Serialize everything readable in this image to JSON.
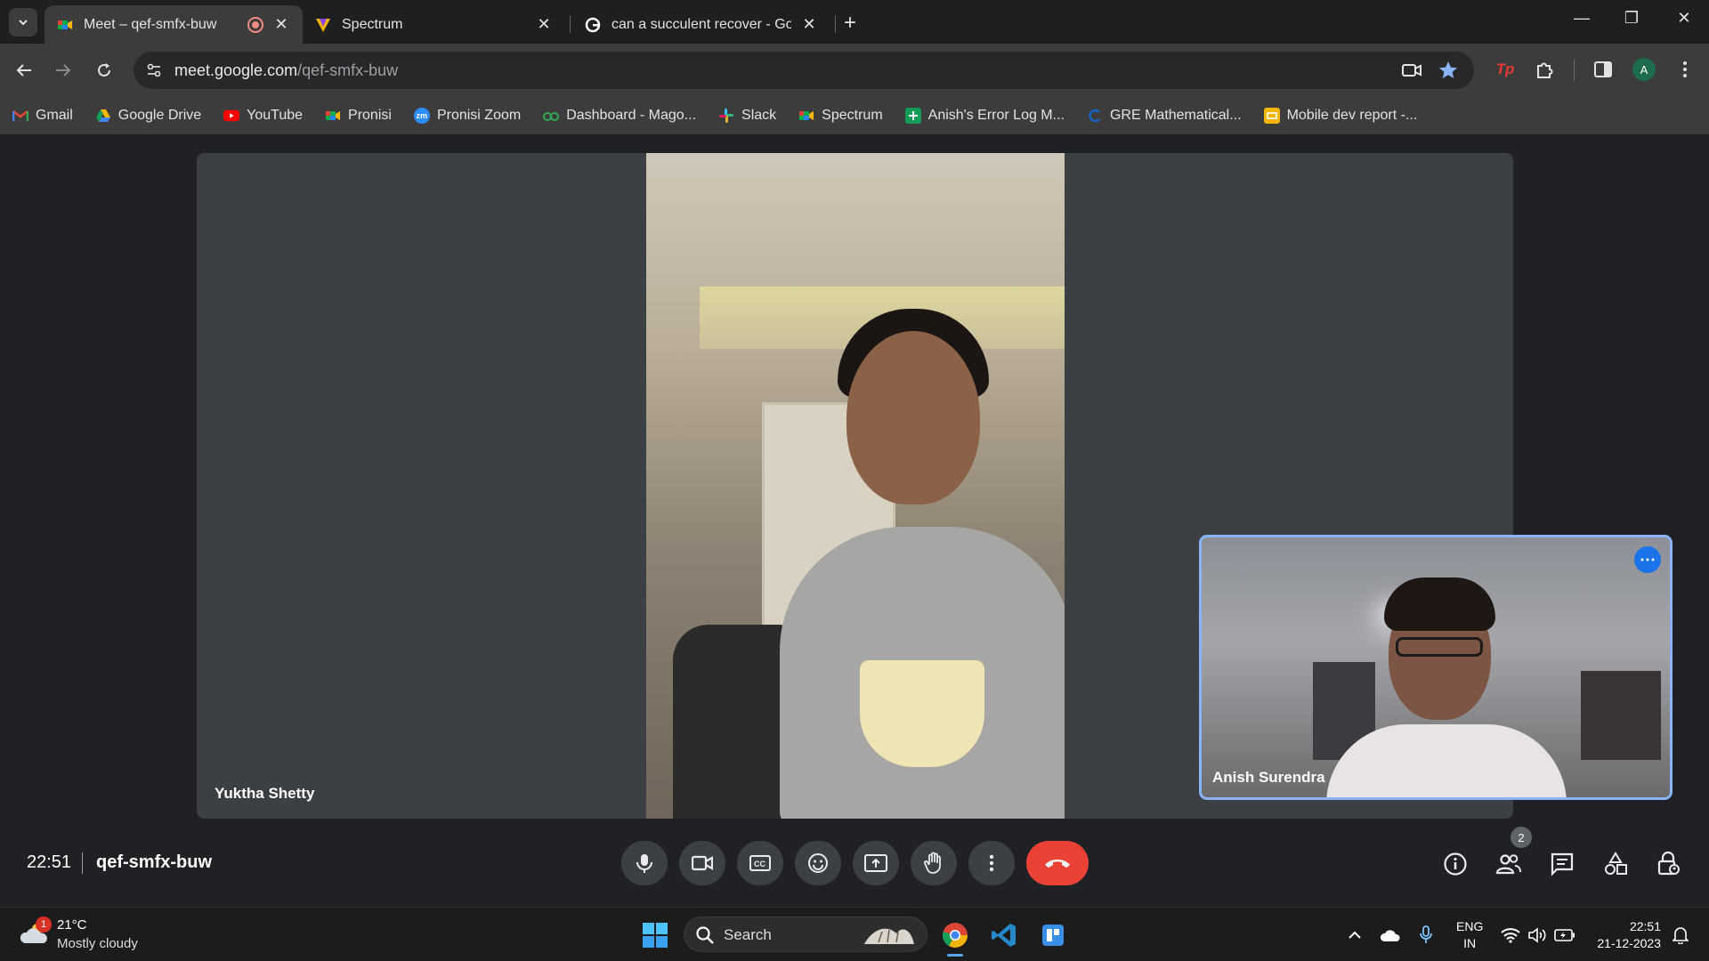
{
  "browser": {
    "tabs": [
      {
        "title": "Meet – qef-smfx-buw",
        "active": true,
        "recording": true
      },
      {
        "title": "Spectrum",
        "active": false
      },
      {
        "title": "can a succulent recover - Google",
        "active": false
      }
    ],
    "url_host": "meet.google.com",
    "url_path": "/qef-smfx-buw",
    "profile_initial": "A",
    "bookmarks": [
      {
        "label": "Gmail",
        "icon": "gmail-icon"
      },
      {
        "label": "Google Drive",
        "icon": "google-drive-icon"
      },
      {
        "label": "YouTube",
        "icon": "youtube-icon"
      },
      {
        "label": "Pronisi",
        "icon": "meet-icon"
      },
      {
        "label": "Pronisi Zoom",
        "icon": "zoom-icon"
      },
      {
        "label": "Dashboard - Mago...",
        "icon": "dashboard-icon"
      },
      {
        "label": "Slack",
        "icon": "slack-icon"
      },
      {
        "label": "Spectrum",
        "icon": "meet-icon"
      },
      {
        "label": "Anish's Error Log M...",
        "icon": "sheets-icon"
      },
      {
        "label": "GRE Mathematical...",
        "icon": "gre-icon"
      },
      {
        "label": "Mobile dev report -...",
        "icon": "slides-icon"
      }
    ]
  },
  "meet": {
    "main_participant": "Yuktha Shetty",
    "self_participant": "Anish Surendra",
    "time": "22:51",
    "meeting_code": "qef-smfx-buw",
    "participant_count": "2"
  },
  "taskbar": {
    "weather_temp": "21°C",
    "weather_desc": "Mostly cloudy",
    "weather_alert_count": "1",
    "search_label": "Search",
    "lang_1": "ENG",
    "lang_2": "IN",
    "clock_time": "22:51",
    "clock_date": "21-12-2023"
  },
  "colors": {
    "accent": "#8ab4f8",
    "end_call": "#ea4335",
    "meet_bg": "#202124",
    "tile_bg": "#3c4043"
  }
}
